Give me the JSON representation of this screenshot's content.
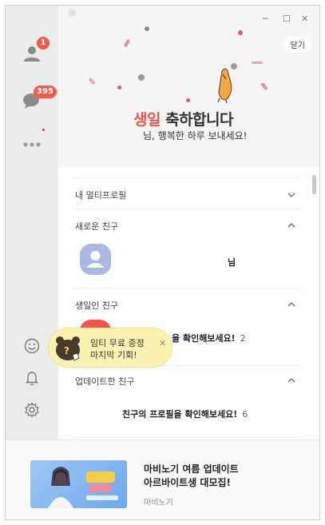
{
  "window": {
    "minimize": "─",
    "maximize": "☐",
    "close": "✕"
  },
  "sidebar": {
    "friends_badge": "1",
    "chats_badge": "395"
  },
  "header": {
    "close_label": "닫기",
    "title_highlight": "생일",
    "title_rest": " 축하합니다",
    "subtitle": "님, 행복한 하루 보내세요!"
  },
  "list": {
    "multi_profile": "내 멀티프로필",
    "new_friends": "새로운 친구",
    "new_friend_suffix": "님",
    "birthday_friends": "생일인 친구",
    "birthday_row_text": "을 확인해보세요!",
    "birthday_row_count": "2",
    "updated_friends": "업데이트한 친구",
    "updated_row_text": "친구의 프로필을 확인해보세요!",
    "updated_row_count": "6"
  },
  "tooltip": {
    "line1": "임티 무료 증정",
    "line2": "마지막 기회!",
    "close": "✕"
  },
  "ad": {
    "title_line1": "마비노기 여름 업데이트",
    "title_line2": "아르바이트생 대모집!",
    "source": "마비노기"
  },
  "colors": {
    "accent_red": "#f25a4a",
    "highlight_pink": "#f2544d",
    "tooltip_yellow": "#fdf2b1"
  }
}
